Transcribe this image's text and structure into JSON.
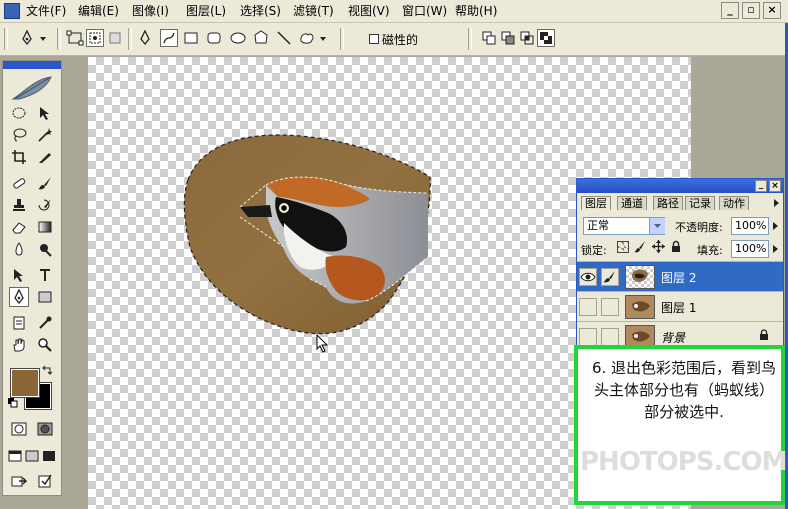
{
  "menu": [
    "文件(F)",
    "编辑(E)",
    "图像(I)",
    "图层(L)",
    "选择(S)",
    "滤镜(T)",
    "视图(V)",
    "窗口(W)",
    "帮助(H)"
  ],
  "window_buttons": {
    "minimize": "_",
    "restore": "▫",
    "close": "×"
  },
  "options_bar": {
    "magnetic_label": "磁性的"
  },
  "layers_panel": {
    "tabs": [
      "图层",
      "通道",
      "路径",
      "记录",
      "动作"
    ],
    "blend_mode": "正常",
    "opacity_label": "不透明度:",
    "opacity_value": "100%",
    "lock_label": "锁定:",
    "fill_label": "填充:",
    "fill_value": "100%",
    "layers": [
      {
        "name": "图层 2",
        "selected": true
      },
      {
        "name": "图层 1",
        "selected": false
      },
      {
        "name": "背景",
        "selected": false
      }
    ]
  },
  "annotation": {
    "text": "6. 退出色彩范围后，看到鸟头主体部分也有（蚂蚁线）部分被选中.",
    "watermark": "PHOTOPS.COM",
    "border_color": "#22d63a"
  },
  "colors": {
    "foreground": "#8a6535",
    "background": "#000000",
    "selection_fill": "#8f6c40"
  }
}
